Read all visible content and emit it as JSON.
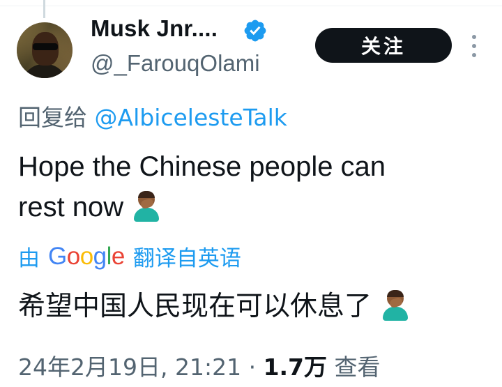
{
  "author": {
    "display_name": "Musk Jnr....",
    "handle": "@_FarouqOlami"
  },
  "follow_button": {
    "label": "关注"
  },
  "reply_to": {
    "prefix": "回复给",
    "mention": "@AlbicelesteTalk"
  },
  "tweet": {
    "line1": "Hope the Chinese people can",
    "line2": "rest now"
  },
  "translation": {
    "by_label": "由",
    "provider": "Google",
    "from_label": "翻译自英语",
    "text": "希望中国人民现在可以休息了"
  },
  "meta": {
    "timestamp": "24年2月19日, 21:21",
    "separator": "·",
    "views_count": "1.7万",
    "views_label": "查看"
  },
  "icons": {
    "verified": "verified-badge-icon",
    "more": "more-vertical-icon",
    "emoji": "man-facepalming-emoji"
  },
  "colors": {
    "accent": "#1d9bf0",
    "text": "#0f1419",
    "secondary": "#536471",
    "button_bg": "#0f1419"
  }
}
